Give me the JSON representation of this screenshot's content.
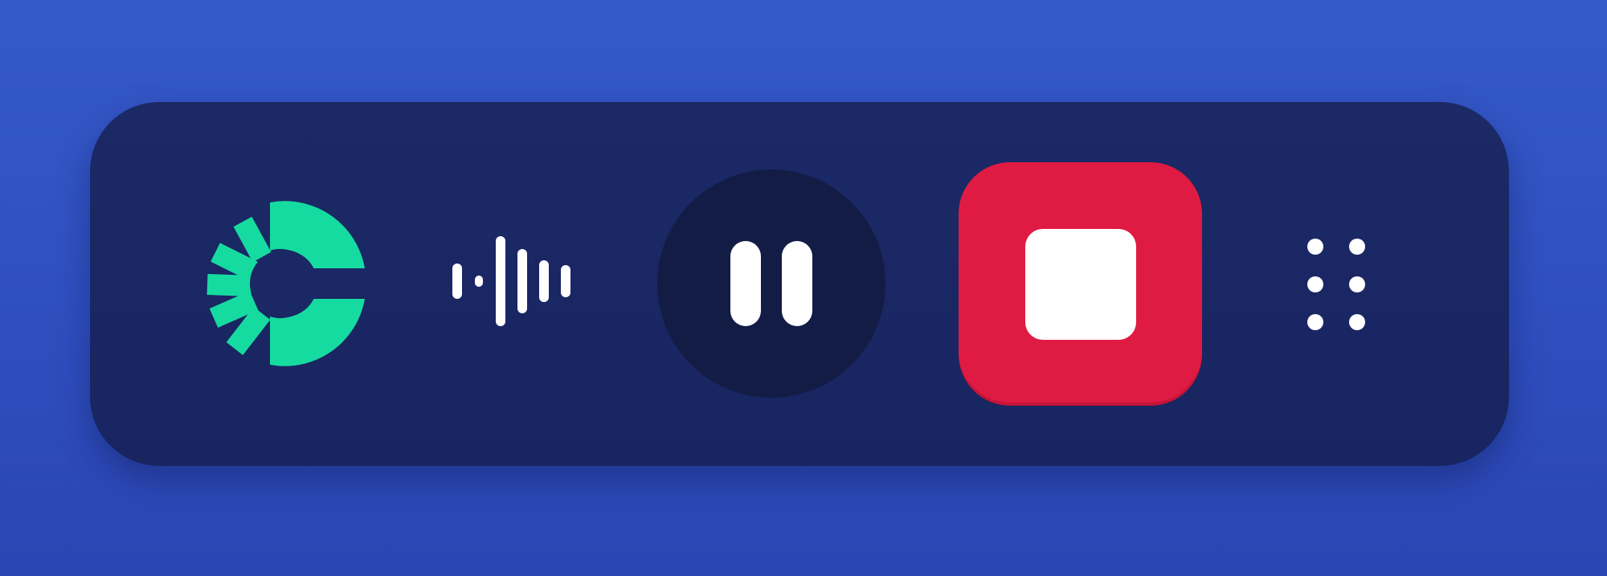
{
  "toolbar": {
    "logo": {
      "icon": "brand-c-logo-icon",
      "color": "#16dba0"
    },
    "waveform": {
      "icon": "audio-waveform-icon",
      "color": "#ffffff"
    },
    "pause": {
      "icon": "pause-icon",
      "background": "#131c45",
      "color": "#ffffff"
    },
    "stop": {
      "icon": "stop-icon",
      "background": "#e01b43",
      "color": "#ffffff"
    },
    "drag": {
      "icon": "drag-handle-icon",
      "color": "#ffffff"
    }
  },
  "colors": {
    "page_background": "#3156c6",
    "toolbar_background": "#1a2864"
  }
}
